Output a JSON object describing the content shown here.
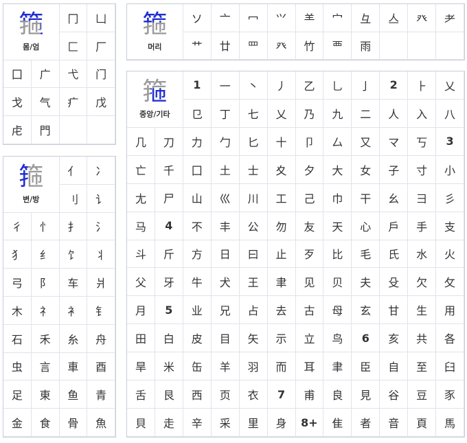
{
  "body_panel": {
    "header": {
      "glyph": "箍",
      "label": "몸/엄"
    },
    "cells": [
      "冂",
      "凵",
      "匚",
      "厂",
      "囗",
      "广",
      "弋",
      "门",
      "戈",
      "气",
      "疒",
      "戊",
      "虍",
      "門",
      "",
      ""
    ]
  },
  "head_panel": {
    "header": {
      "glyph": "箍",
      "label": "머리"
    },
    "cells": [
      "ソ",
      "亠",
      "冖",
      "⺍",
      "⺷",
      "宀",
      "彑",
      "亼",
      "癶",
      "耂",
      "艹",
      "廿",
      "罒",
      "癶",
      "竹",
      "覀",
      "雨",
      "",
      "",
      ""
    ]
  },
  "side_panel": {
    "header": {
      "glyph": "箍",
      "label": "변/방"
    },
    "cells": [
      "亻",
      "冫",
      "刂",
      "讠",
      "彳",
      "忄",
      "扌",
      "氵",
      "犭",
      "纟",
      "饣",
      "丬",
      "弓",
      "阝",
      "车",
      "爿",
      "木",
      "礻",
      "衤",
      "钅",
      "石",
      "禾",
      "糸",
      "舟",
      "虫",
      "言",
      "車",
      "酉",
      "足",
      "東",
      "鱼",
      "青",
      "金",
      "食",
      "骨",
      "魚"
    ]
  },
  "center_panel": {
    "header": {
      "glyph": "箍",
      "label": "중앙/기타"
    },
    "cells": [
      {
        "t": "1",
        "n": true
      },
      {
        "t": "一"
      },
      {
        "t": "丶"
      },
      {
        "t": "丿"
      },
      {
        "t": "乙"
      },
      {
        "t": "乚"
      },
      {
        "t": "亅"
      },
      {
        "t": "2",
        "n": true
      },
      {
        "t": "⺊"
      },
      {
        "t": "乂"
      },
      {
        "t": "㔾"
      },
      {
        "t": "丁"
      },
      {
        "t": "七"
      },
      {
        "t": "乂"
      },
      {
        "t": "乃"
      },
      {
        "t": "九"
      },
      {
        "t": "二"
      },
      {
        "t": "人"
      },
      {
        "t": "入"
      },
      {
        "t": "八"
      },
      {
        "t": "几"
      },
      {
        "t": "刀"
      },
      {
        "t": "力"
      },
      {
        "t": "勹"
      },
      {
        "t": "匕"
      },
      {
        "t": "十"
      },
      {
        "t": "卩"
      },
      {
        "t": "厶"
      },
      {
        "t": "又"
      },
      {
        "t": "マ"
      },
      {
        "t": "丂"
      },
      {
        "t": "3",
        "n": true
      },
      {
        "t": "亡"
      },
      {
        "t": "千"
      },
      {
        "t": "囗"
      },
      {
        "t": "土"
      },
      {
        "t": "士"
      },
      {
        "t": "夊"
      },
      {
        "t": "夕"
      },
      {
        "t": "大"
      },
      {
        "t": "女"
      },
      {
        "t": "子"
      },
      {
        "t": "寸"
      },
      {
        "t": "小"
      },
      {
        "t": "尢"
      },
      {
        "t": "尸"
      },
      {
        "t": "山"
      },
      {
        "t": "巛"
      },
      {
        "t": "川"
      },
      {
        "t": "工"
      },
      {
        "t": "己"
      },
      {
        "t": "巾"
      },
      {
        "t": "干"
      },
      {
        "t": "幺"
      },
      {
        "t": "彐"
      },
      {
        "t": "彡"
      },
      {
        "t": "马"
      },
      {
        "t": "4",
        "n": true
      },
      {
        "t": "不"
      },
      {
        "t": "丰"
      },
      {
        "t": "公"
      },
      {
        "t": "勿"
      },
      {
        "t": "友"
      },
      {
        "t": "天"
      },
      {
        "t": "心"
      },
      {
        "t": "戶"
      },
      {
        "t": "手"
      },
      {
        "t": "支"
      },
      {
        "t": "斗"
      },
      {
        "t": "斤"
      },
      {
        "t": "方"
      },
      {
        "t": "日"
      },
      {
        "t": "曰"
      },
      {
        "t": "止"
      },
      {
        "t": "歹"
      },
      {
        "t": "比"
      },
      {
        "t": "毛"
      },
      {
        "t": "氏"
      },
      {
        "t": "水"
      },
      {
        "t": "火"
      },
      {
        "t": "父"
      },
      {
        "t": "牙"
      },
      {
        "t": "牛"
      },
      {
        "t": "犬"
      },
      {
        "t": "王"
      },
      {
        "t": "聿"
      },
      {
        "t": "见"
      },
      {
        "t": "贝"
      },
      {
        "t": "夫"
      },
      {
        "t": "殳"
      },
      {
        "t": "欠"
      },
      {
        "t": "攵"
      },
      {
        "t": "月"
      },
      {
        "t": "5",
        "n": true
      },
      {
        "t": "业"
      },
      {
        "t": "兄"
      },
      {
        "t": "占"
      },
      {
        "t": "去"
      },
      {
        "t": "古"
      },
      {
        "t": "母"
      },
      {
        "t": "玄"
      },
      {
        "t": "甘"
      },
      {
        "t": "生"
      },
      {
        "t": "用"
      },
      {
        "t": "田"
      },
      {
        "t": "白"
      },
      {
        "t": "皮"
      },
      {
        "t": "目"
      },
      {
        "t": "矢"
      },
      {
        "t": "示"
      },
      {
        "t": "立"
      },
      {
        "t": "鸟"
      },
      {
        "t": "6",
        "n": true
      },
      {
        "t": "亥"
      },
      {
        "t": "共"
      },
      {
        "t": "各"
      },
      {
        "t": "旱"
      },
      {
        "t": "米"
      },
      {
        "t": "缶"
      },
      {
        "t": "羊"
      },
      {
        "t": "羽"
      },
      {
        "t": "而"
      },
      {
        "t": "耳"
      },
      {
        "t": "聿"
      },
      {
        "t": "臣"
      },
      {
        "t": "自"
      },
      {
        "t": "至"
      },
      {
        "t": "臼"
      },
      {
        "t": "舌"
      },
      {
        "t": "艮"
      },
      {
        "t": "西"
      },
      {
        "t": "页"
      },
      {
        "t": "衣"
      },
      {
        "t": "7",
        "n": true
      },
      {
        "t": "甫"
      },
      {
        "t": "良"
      },
      {
        "t": "見"
      },
      {
        "t": "谷"
      },
      {
        "t": "豆"
      },
      {
        "t": "豕"
      },
      {
        "t": "貝"
      },
      {
        "t": "走"
      },
      {
        "t": "辛"
      },
      {
        "t": "采"
      },
      {
        "t": "里"
      },
      {
        "t": "身"
      },
      {
        "t": "8+",
        "n": true
      },
      {
        "t": "隹"
      },
      {
        "t": "者"
      },
      {
        "t": "音"
      },
      {
        "t": "頁"
      },
      {
        "t": "馬"
      }
    ]
  },
  "colors": {
    "accent": "#1f2ed6",
    "gray": "#9a9a9a",
    "border": "#c9ccd6"
  }
}
